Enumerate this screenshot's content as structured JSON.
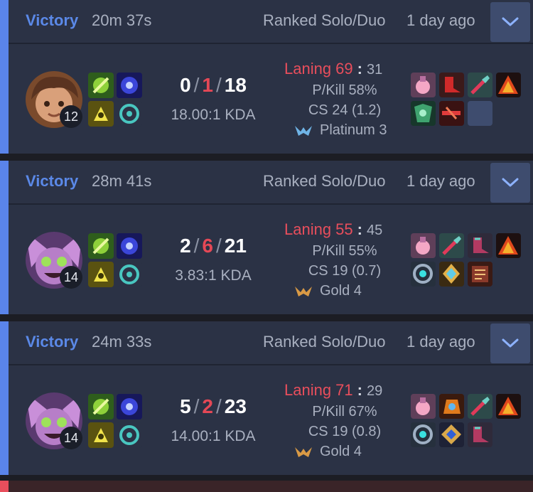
{
  "matches": [
    {
      "result": "Victory",
      "duration": "20m 37s",
      "queue": "Ranked Solo/Duo",
      "ago": "1 day ago",
      "champion_icon": "young-champion-portrait",
      "level": "12",
      "kills": "0",
      "deaths": "1",
      "assists": "18",
      "kda": "18.00:1 KDA",
      "laning_label": "Laning 69",
      "laning_opp": "31",
      "pkill": "P/Kill 58%",
      "cs": "CS 24 (1.2)",
      "rank": "Platinum 3",
      "rank_color": "#6fb4e6"
    },
    {
      "result": "Victory",
      "duration": "28m 41s",
      "queue": "Ranked Solo/Duo",
      "ago": "1 day ago",
      "champion_icon": "yordle-champion-portrait",
      "level": "14",
      "kills": "2",
      "deaths": "6",
      "assists": "21",
      "kda": "3.83:1 KDA",
      "laning_label": "Laning 55",
      "laning_opp": "45",
      "pkill": "P/Kill 55%",
      "cs": "CS 19 (0.7)",
      "rank": "Gold 4",
      "rank_color": "#d99a45"
    },
    {
      "result": "Victory",
      "duration": "24m 33s",
      "queue": "Ranked Solo/Duo",
      "ago": "1 day ago",
      "champion_icon": "yordle-champion-portrait",
      "level": "14",
      "kills": "5",
      "deaths": "2",
      "assists": "23",
      "kda": "14.00:1 KDA",
      "laning_label": "Laning 71",
      "laning_opp": "29",
      "pkill": "P/Kill 67%",
      "cs": "CS 19 (0.8)",
      "rank": "Gold 4",
      "rank_color": "#d99a45"
    }
  ],
  "colors": {
    "victory": "#5b89e8",
    "accent_bar": "#5a84ea",
    "death": "#e54856",
    "laning": "#e84e5c",
    "card_bg": "#2b3245"
  }
}
